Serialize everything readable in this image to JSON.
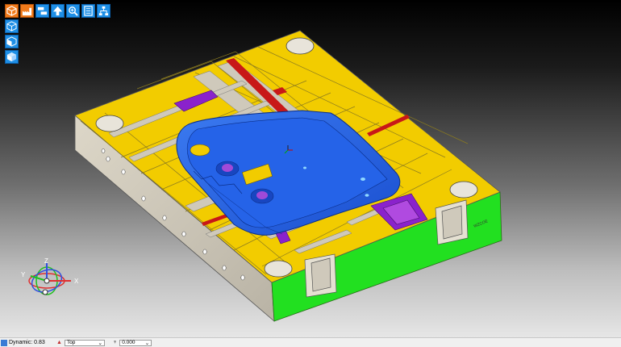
{
  "toolbar": {
    "row": [
      {
        "icon": "orange-cube-icon",
        "color": "#f07a1a"
      },
      {
        "icon": "orange-factory-icon",
        "color": "#f07a1a"
      },
      {
        "icon": "mold-split-icon",
        "color": "#1e8fe6"
      },
      {
        "icon": "up-arrow-icon",
        "color": "#1e8fe6"
      },
      {
        "icon": "zoom-icon",
        "color": "#1e8fe6"
      },
      {
        "icon": "list-icon",
        "color": "#1e8fe6"
      },
      {
        "icon": "hierarchy-icon",
        "color": "#1e8fe6"
      }
    ],
    "column": [
      {
        "icon": "cube-wire-icon"
      },
      {
        "icon": "cube-front-icon"
      },
      {
        "icon": "cube-shaded-icon"
      }
    ]
  },
  "triad": {
    "x_label": "X",
    "y_label": "Y",
    "z_label": "Z"
  },
  "model": {
    "engraving": "WZCOE",
    "colors": {
      "plate": "#f2cc00",
      "side_green": "#22e020",
      "side_grey": "#cfc9bb",
      "cavity_blue": "#1c5be6",
      "insert_purple": "#8a22cc",
      "rail_red": "#c81818"
    }
  },
  "status": {
    "render_mode": "Dynamic: 0.83",
    "view": "Top",
    "offset": "0.000"
  }
}
